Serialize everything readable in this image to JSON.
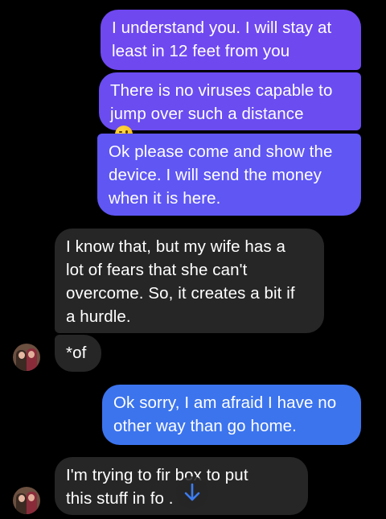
{
  "messages": [
    {
      "direction": "outgoing",
      "text": "I understand you. I will stay at\nleast in 12 feet from you"
    },
    {
      "direction": "outgoing",
      "text": "There is no viruses capable to\njump over such a distance",
      "emoji": "winking-face"
    },
    {
      "direction": "outgoing",
      "text": "Ok please come and show the\ndevice. I will send the money\nwhen it is here."
    },
    {
      "direction": "incoming",
      "text": "I know that, but my wife has a\nlot of fears that she can't\novercome. So, it creates a bit if\na hurdle."
    },
    {
      "direction": "incoming",
      "text": "*of"
    },
    {
      "direction": "outgoing",
      "text": "Ok sorry, I am afraid I have no\nother way than go home."
    },
    {
      "direction": "incoming",
      "text": "I'm trying to fir   box to put\nthis stuff in fo       ."
    }
  ],
  "colors": {
    "background": "#000000",
    "outgoing_gradient_top": "#6f48f0",
    "outgoing_gradient_bottom": "#3c74ee",
    "incoming_bubble": "#262626",
    "scroll_arrow": "#3c7cf0"
  },
  "icons": {
    "scroll_down": "arrow-down-icon",
    "avatar": "contact-avatar"
  }
}
